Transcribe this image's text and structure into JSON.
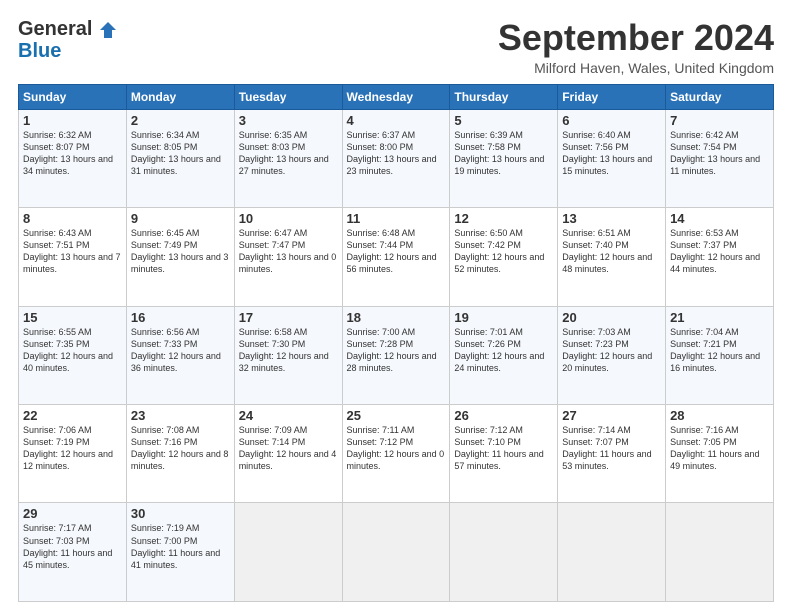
{
  "header": {
    "logo_general": "General",
    "logo_blue": "Blue",
    "month_title": "September 2024",
    "location": "Milford Haven, Wales, United Kingdom"
  },
  "days_of_week": [
    "Sunday",
    "Monday",
    "Tuesday",
    "Wednesday",
    "Thursday",
    "Friday",
    "Saturday"
  ],
  "weeks": [
    [
      {
        "num": "1",
        "sunrise": "Sunrise: 6:32 AM",
        "sunset": "Sunset: 8:07 PM",
        "daylight": "Daylight: 13 hours and 34 minutes."
      },
      {
        "num": "2",
        "sunrise": "Sunrise: 6:34 AM",
        "sunset": "Sunset: 8:05 PM",
        "daylight": "Daylight: 13 hours and 31 minutes."
      },
      {
        "num": "3",
        "sunrise": "Sunrise: 6:35 AM",
        "sunset": "Sunset: 8:03 PM",
        "daylight": "Daylight: 13 hours and 27 minutes."
      },
      {
        "num": "4",
        "sunrise": "Sunrise: 6:37 AM",
        "sunset": "Sunset: 8:00 PM",
        "daylight": "Daylight: 13 hours and 23 minutes."
      },
      {
        "num": "5",
        "sunrise": "Sunrise: 6:39 AM",
        "sunset": "Sunset: 7:58 PM",
        "daylight": "Daylight: 13 hours and 19 minutes."
      },
      {
        "num": "6",
        "sunrise": "Sunrise: 6:40 AM",
        "sunset": "Sunset: 7:56 PM",
        "daylight": "Daylight: 13 hours and 15 minutes."
      },
      {
        "num": "7",
        "sunrise": "Sunrise: 6:42 AM",
        "sunset": "Sunset: 7:54 PM",
        "daylight": "Daylight: 13 hours and 11 minutes."
      }
    ],
    [
      {
        "num": "8",
        "sunrise": "Sunrise: 6:43 AM",
        "sunset": "Sunset: 7:51 PM",
        "daylight": "Daylight: 13 hours and 7 minutes."
      },
      {
        "num": "9",
        "sunrise": "Sunrise: 6:45 AM",
        "sunset": "Sunset: 7:49 PM",
        "daylight": "Daylight: 13 hours and 3 minutes."
      },
      {
        "num": "10",
        "sunrise": "Sunrise: 6:47 AM",
        "sunset": "Sunset: 7:47 PM",
        "daylight": "Daylight: 13 hours and 0 minutes."
      },
      {
        "num": "11",
        "sunrise": "Sunrise: 6:48 AM",
        "sunset": "Sunset: 7:44 PM",
        "daylight": "Daylight: 12 hours and 56 minutes."
      },
      {
        "num": "12",
        "sunrise": "Sunrise: 6:50 AM",
        "sunset": "Sunset: 7:42 PM",
        "daylight": "Daylight: 12 hours and 52 minutes."
      },
      {
        "num": "13",
        "sunrise": "Sunrise: 6:51 AM",
        "sunset": "Sunset: 7:40 PM",
        "daylight": "Daylight: 12 hours and 48 minutes."
      },
      {
        "num": "14",
        "sunrise": "Sunrise: 6:53 AM",
        "sunset": "Sunset: 7:37 PM",
        "daylight": "Daylight: 12 hours and 44 minutes."
      }
    ],
    [
      {
        "num": "15",
        "sunrise": "Sunrise: 6:55 AM",
        "sunset": "Sunset: 7:35 PM",
        "daylight": "Daylight: 12 hours and 40 minutes."
      },
      {
        "num": "16",
        "sunrise": "Sunrise: 6:56 AM",
        "sunset": "Sunset: 7:33 PM",
        "daylight": "Daylight: 12 hours and 36 minutes."
      },
      {
        "num": "17",
        "sunrise": "Sunrise: 6:58 AM",
        "sunset": "Sunset: 7:30 PM",
        "daylight": "Daylight: 12 hours and 32 minutes."
      },
      {
        "num": "18",
        "sunrise": "Sunrise: 7:00 AM",
        "sunset": "Sunset: 7:28 PM",
        "daylight": "Daylight: 12 hours and 28 minutes."
      },
      {
        "num": "19",
        "sunrise": "Sunrise: 7:01 AM",
        "sunset": "Sunset: 7:26 PM",
        "daylight": "Daylight: 12 hours and 24 minutes."
      },
      {
        "num": "20",
        "sunrise": "Sunrise: 7:03 AM",
        "sunset": "Sunset: 7:23 PM",
        "daylight": "Daylight: 12 hours and 20 minutes."
      },
      {
        "num": "21",
        "sunrise": "Sunrise: 7:04 AM",
        "sunset": "Sunset: 7:21 PM",
        "daylight": "Daylight: 12 hours and 16 minutes."
      }
    ],
    [
      {
        "num": "22",
        "sunrise": "Sunrise: 7:06 AM",
        "sunset": "Sunset: 7:19 PM",
        "daylight": "Daylight: 12 hours and 12 minutes."
      },
      {
        "num": "23",
        "sunrise": "Sunrise: 7:08 AM",
        "sunset": "Sunset: 7:16 PM",
        "daylight": "Daylight: 12 hours and 8 minutes."
      },
      {
        "num": "24",
        "sunrise": "Sunrise: 7:09 AM",
        "sunset": "Sunset: 7:14 PM",
        "daylight": "Daylight: 12 hours and 4 minutes."
      },
      {
        "num": "25",
        "sunrise": "Sunrise: 7:11 AM",
        "sunset": "Sunset: 7:12 PM",
        "daylight": "Daylight: 12 hours and 0 minutes."
      },
      {
        "num": "26",
        "sunrise": "Sunrise: 7:12 AM",
        "sunset": "Sunset: 7:10 PM",
        "daylight": "Daylight: 11 hours and 57 minutes."
      },
      {
        "num": "27",
        "sunrise": "Sunrise: 7:14 AM",
        "sunset": "Sunset: 7:07 PM",
        "daylight": "Daylight: 11 hours and 53 minutes."
      },
      {
        "num": "28",
        "sunrise": "Sunrise: 7:16 AM",
        "sunset": "Sunset: 7:05 PM",
        "daylight": "Daylight: 11 hours and 49 minutes."
      }
    ],
    [
      {
        "num": "29",
        "sunrise": "Sunrise: 7:17 AM",
        "sunset": "Sunset: 7:03 PM",
        "daylight": "Daylight: 11 hours and 45 minutes."
      },
      {
        "num": "30",
        "sunrise": "Sunrise: 7:19 AM",
        "sunset": "Sunset: 7:00 PM",
        "daylight": "Daylight: 11 hours and 41 minutes."
      },
      null,
      null,
      null,
      null,
      null
    ]
  ]
}
